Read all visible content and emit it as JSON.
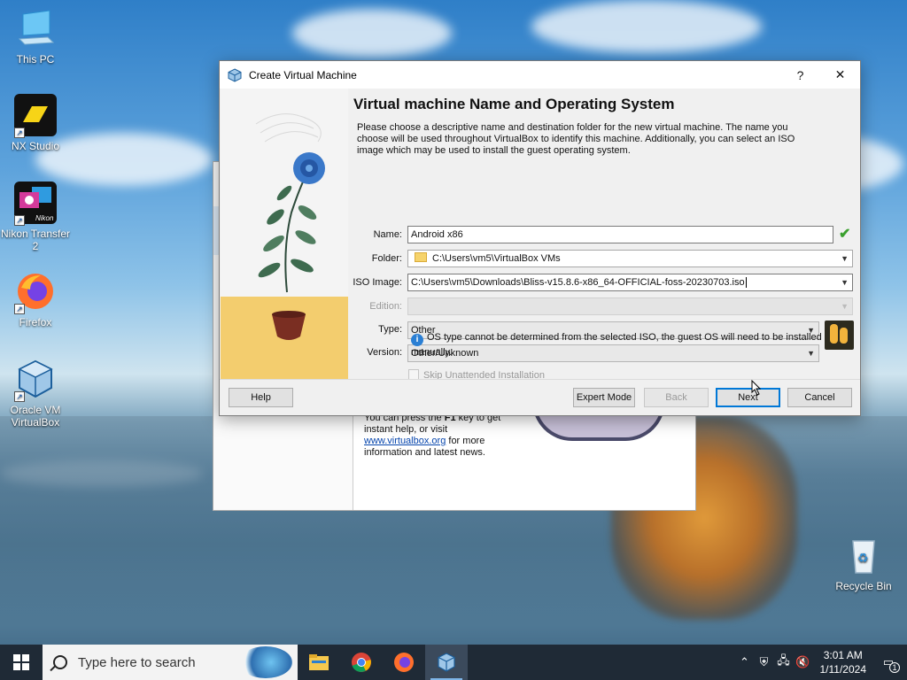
{
  "desktop": {
    "icons": [
      {
        "label": "This PC"
      },
      {
        "label": "NX Studio"
      },
      {
        "label": "Nikon Transfer 2"
      },
      {
        "label": "Firefox"
      },
      {
        "label": "Oracle VM VirtualBox"
      },
      {
        "label": "Recycle Bin"
      }
    ]
  },
  "background_window": {
    "welcome_text_1": "You can press the ",
    "welcome_key": "F1",
    "welcome_text_2": " key to get instant help, or visit ",
    "welcome_link": "www.virtualbox.org",
    "welcome_text_3": " for more information and latest news."
  },
  "dialog": {
    "title": "Create Virtual Machine",
    "help_glyph": "?",
    "close_glyph": "✕",
    "heading": "Virtual machine Name and Operating System",
    "description": "Please choose a descriptive name and destination folder for the new virtual machine. The name you choose will be used throughout VirtualBox to identify this machine. Additionally, you can select an ISO image which may be used to install the guest operating system.",
    "fields": {
      "name_label": "Name:",
      "name_value": "Android x86",
      "folder_label": "Folder:",
      "folder_value": "C:\\Users\\vm5\\VirtualBox VMs",
      "iso_label": "ISO Image:",
      "iso_value": "C:\\Users\\vm5\\Downloads\\Bliss-v15.8.6-x86_64-OFFICIAL-foss-20230703.iso",
      "edition_label": "Edition:",
      "edition_value": "",
      "type_label": "Type:",
      "type_value": "Other",
      "version_label": "Version:",
      "version_value": "Other/Unknown",
      "skip_unattended_label": "Skip Unattended Installation"
    },
    "info_message": "OS type cannot be determined from the selected ISO, the guest OS will need to be installed manually.",
    "buttons": {
      "help": "Help",
      "expert_mode": "Expert Mode",
      "back": "Back",
      "next": "Next",
      "cancel": "Cancel"
    }
  },
  "taskbar": {
    "search_placeholder": "Type here to search",
    "time": "3:01 AM",
    "date": "1/11/2024",
    "notification_count": "1"
  },
  "colors": {
    "accent": "#0078d7",
    "taskbar": "#1f2a36",
    "sand": "#f3cd6e"
  }
}
